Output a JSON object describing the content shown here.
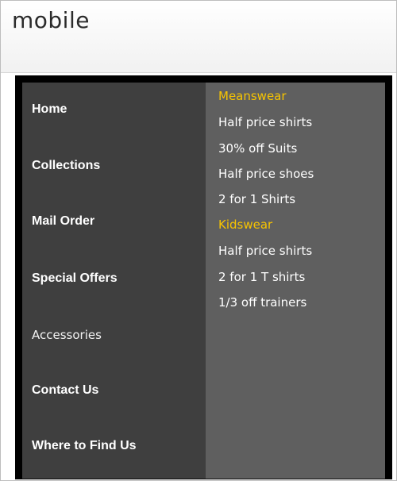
{
  "brand": {
    "name": "mobile"
  },
  "menu": {
    "items": [
      "Home",
      "Collections",
      "Mail Order",
      "Special Offers",
      "Accessories",
      "Contact Us",
      "Where to Find Us"
    ]
  },
  "offers": {
    "menswear_heading": "Meanswear",
    "menswear_items": [
      "Half price shirts",
      "30% off Suits",
      "Half price shoes",
      "2 for 1 Shirts"
    ],
    "kidswear_heading": "Kidswear",
    "kidswear_items": [
      "Half price shirts",
      "2 for 1 T shirts",
      "1/3 off trainers"
    ]
  }
}
